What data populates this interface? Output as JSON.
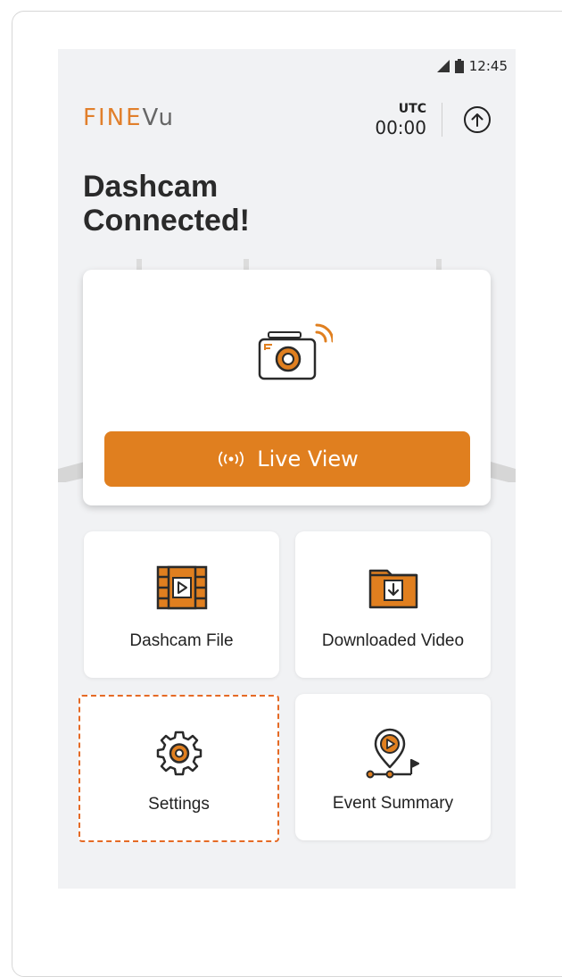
{
  "status_bar": {
    "time": "12:45"
  },
  "header": {
    "logo": {
      "part1": "FINE",
      "part2": "Vu"
    },
    "utc_label": "UTC",
    "utc_time": "00:00",
    "upload_icon": "arrow-up-circle-icon"
  },
  "title": "Dashcam\nConnected!",
  "hero": {
    "camera_icon": "dashcam-wifi-icon",
    "live_view_label": "Live View",
    "live_view_icon": "broadcast-icon"
  },
  "tiles": [
    {
      "label": "Dashcam File",
      "icon": "film-play-icon"
    },
    {
      "label": "Downloaded Video",
      "icon": "folder-download-icon"
    },
    {
      "label": "Settings",
      "icon": "gear-icon"
    },
    {
      "label": "Event Summary",
      "icon": "event-route-icon"
    }
  ],
  "colors": {
    "accent": "#e07f1f",
    "background": "#f1f2f4",
    "focus_outline": "#e56a25"
  }
}
